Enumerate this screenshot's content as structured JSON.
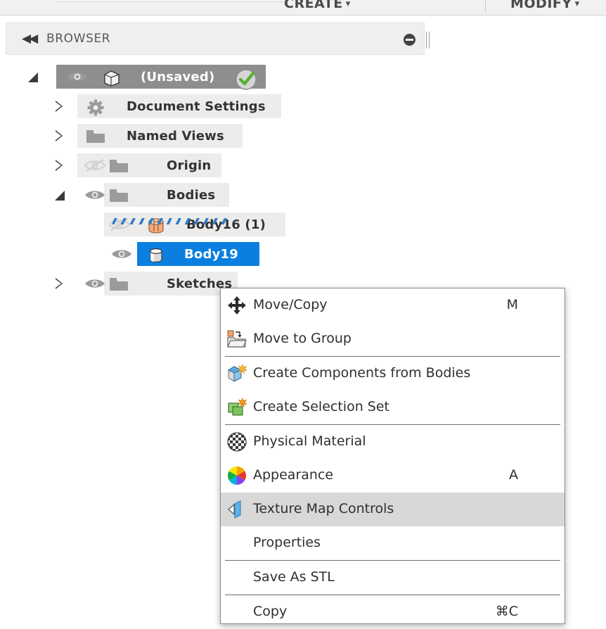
{
  "toolbar": {
    "create_label": "CREATE",
    "modify_label": "MODIFY",
    "caret": "▾"
  },
  "browser_panel": {
    "title": "BROWSER",
    "collapse_icon": "◀◀",
    "minimize_icon": "minus-circle-icon",
    "grip_icon": "resize-grip-icon"
  },
  "tree": {
    "items": [
      {
        "label": "(Unsaved)",
        "icon": "component-cube-icon",
        "twisty": "open",
        "eye": "visible",
        "state": "root",
        "indent": 0
      },
      {
        "label": "Document Settings",
        "icon": "gear-icon",
        "twisty": "closed",
        "eye": "none",
        "state": "normal",
        "indent": 1
      },
      {
        "label": "Named Views",
        "icon": "folder-icon",
        "twisty": "closed",
        "eye": "none",
        "state": "normal",
        "indent": 1
      },
      {
        "label": "Origin",
        "icon": "folder-icon",
        "twisty": "closed",
        "eye": "hidden",
        "state": "normal",
        "indent": 1
      },
      {
        "label": "Bodies",
        "icon": "folder-icon",
        "twisty": "open",
        "eye": "visible",
        "state": "droptarget",
        "indent": 1
      },
      {
        "label": "Body16 (1)",
        "icon": "body-orange-icon",
        "twisty": "none",
        "eye": "hidden",
        "state": "normal",
        "indent": 2
      },
      {
        "label": "Body19",
        "icon": "body-grey-icon",
        "twisty": "none",
        "eye": "visible",
        "state": "selected",
        "indent": 2
      },
      {
        "label": "Sketches",
        "icon": "folder-icon",
        "twisty": "closed",
        "eye": "visible",
        "state": "normal",
        "indent": 1
      }
    ]
  },
  "context_menu": {
    "items": [
      {
        "label": "Move/Copy",
        "shortcut": "M",
        "icon": "move-arrows-icon",
        "highlighted": false,
        "separator_after": false
      },
      {
        "label": "Move to Group",
        "shortcut": "",
        "icon": "move-to-folder-icon",
        "highlighted": false,
        "separator_after": true
      },
      {
        "label": "Create Components from Bodies",
        "shortcut": "",
        "icon": "create-components-icon",
        "highlighted": false,
        "separator_after": false
      },
      {
        "label": "Create Selection Set",
        "shortcut": "",
        "icon": "selection-set-icon",
        "highlighted": false,
        "separator_after": true
      },
      {
        "label": "Physical Material",
        "shortcut": "",
        "icon": "checker-sphere-icon",
        "highlighted": false,
        "separator_after": false
      },
      {
        "label": "Appearance",
        "shortcut": "A",
        "icon": "color-wheel-icon",
        "highlighted": false,
        "separator_after": false
      },
      {
        "label": "Texture Map Controls",
        "shortcut": "",
        "icon": "texture-map-icon",
        "highlighted": true,
        "separator_after": false
      },
      {
        "label": "Properties",
        "shortcut": "",
        "icon": "none",
        "highlighted": false,
        "separator_after": true
      },
      {
        "label": "Save As STL",
        "shortcut": "",
        "icon": "none",
        "highlighted": false,
        "separator_after": true
      },
      {
        "label": "Copy",
        "shortcut": "⌘C",
        "icon": "none",
        "highlighted": false,
        "separator_after": false
      }
    ]
  },
  "colors": {
    "selection_blue": "#0a7fe0",
    "root_grey": "#8e8e8e",
    "row_grey": "#ececec",
    "highlight_grey": "#d8d8d8",
    "doc_marker_orange": "#f26522",
    "drop_indicator_blue": "#2f7ec4"
  }
}
